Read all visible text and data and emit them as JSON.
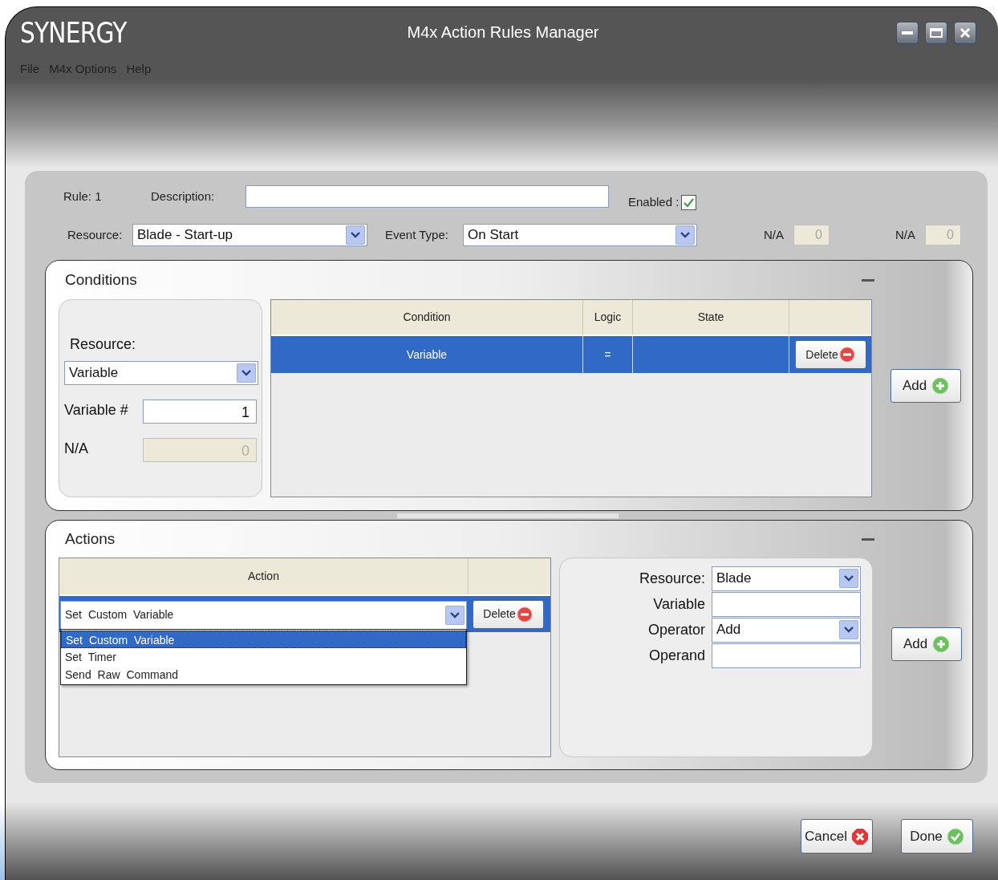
{
  "window": {
    "title": "M4x Action Rules Manager",
    "logo": "SYNERGY"
  },
  "menu": [
    {
      "label": "File"
    },
    {
      "label": "M4x Options"
    },
    {
      "label": "Help"
    }
  ],
  "rule": {
    "label": "Rule: 1",
    "description_label": "Description:",
    "enabled_label": "Enabled :",
    "enabled": true
  },
  "trigger": {
    "resource_label": "Resource:",
    "resource_value": "Blade - Start-up",
    "event_label": "Event Type:",
    "event_value": "On Start",
    "na_fields": [
      {
        "label": "N/A",
        "value": "0",
        "disabled": true
      },
      {
        "label": "N/A",
        "value": "0",
        "disabled": true
      }
    ]
  },
  "conditions": {
    "title": "Conditions",
    "editor": [
      {
        "kind": "select",
        "label": "Resource:",
        "value": "Variable"
      },
      {
        "kind": "input",
        "label": "Variable #",
        "value": "1",
        "disabled": false
      },
      {
        "kind": "input",
        "label": "N/A",
        "value": "0",
        "disabled": true
      }
    ],
    "table": {
      "columns": [
        "Condition",
        "Logic",
        "State"
      ],
      "rows": [
        {
          "condition": "Variable",
          "logic": "=",
          "selected": true,
          "button": "Delete"
        }
      ]
    },
    "add_button": "Add"
  },
  "actions": {
    "title": "Actions",
    "table": {
      "columns": [
        "Action"
      ],
      "rows": [
        {
          "action": "Set Custom Variable",
          "selected": true,
          "button": "Delete",
          "options": [
            {
              "label": "Set Custom Variable",
              "selected": true
            },
            {
              "label": "Set Timer",
              "selected": false
            },
            {
              "label": "Send Raw Command",
              "selected": false
            }
          ]
        }
      ]
    },
    "editor": [
      {
        "kind": "select",
        "label": "Resource:",
        "value": "Blade"
      },
      {
        "kind": "input",
        "label": "Variable"
      },
      {
        "kind": "select",
        "label": "Operator",
        "value": "Add"
      },
      {
        "kind": "input",
        "label": "Operand"
      }
    ],
    "add_button": "Add"
  },
  "footer_buttons": [
    {
      "kind": "cancel",
      "label": "Cancel"
    },
    {
      "kind": "done",
      "label": "Done"
    }
  ]
}
